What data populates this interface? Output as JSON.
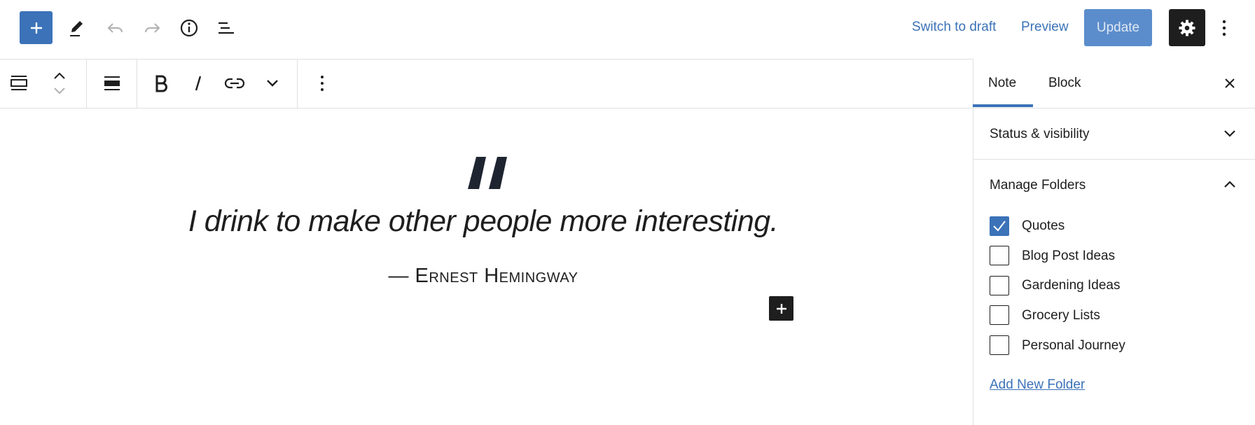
{
  "header": {
    "switch_to_draft": "Switch to draft",
    "preview": "Preview",
    "update": "Update"
  },
  "sidebar": {
    "tabs": [
      {
        "label": "Note"
      },
      {
        "label": "Block"
      }
    ],
    "panels": {
      "status": "Status & visibility",
      "folders": "Manage Folders"
    },
    "folders": [
      {
        "label": "Quotes",
        "checked": true
      },
      {
        "label": "Blog Post Ideas",
        "checked": false
      },
      {
        "label": "Gardening Ideas",
        "checked": false
      },
      {
        "label": "Grocery Lists",
        "checked": false
      },
      {
        "label": "Personal Journey",
        "checked": false
      }
    ],
    "add_folder": "Add New Folder"
  },
  "content": {
    "quote": "I drink to make other people more interesting.",
    "citation": "— Ernest Hemingway"
  },
  "colors": {
    "accent": "#3b72b8",
    "dark": "#1e1e1e"
  }
}
